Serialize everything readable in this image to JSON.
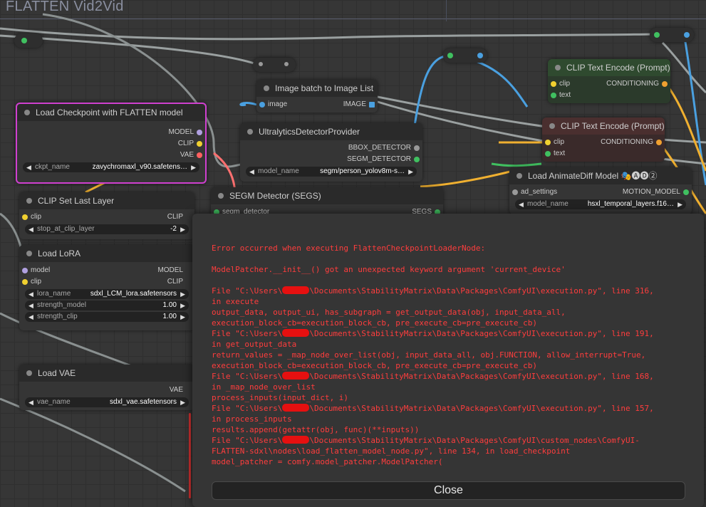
{
  "canvas": {
    "group_title": "FLATTEN Vid2Vid"
  },
  "nodes": {
    "load_checkpoint": {
      "title": "Load Checkpoint with FLATTEN model",
      "outputs": [
        "MODEL",
        "CLIP",
        "VAE"
      ],
      "widget_name": "ckpt_name",
      "widget_value": "zavychromaxl_v90.safetens…"
    },
    "clip_set_last_layer": {
      "title": "CLIP Set Last Layer",
      "input": "clip",
      "output": "CLIP",
      "widget_name": "stop_at_clip_layer",
      "widget_value": "-2"
    },
    "load_lora": {
      "title": "Load LoRA",
      "inputs": [
        "model",
        "clip"
      ],
      "outputs": [
        "MODEL",
        "CLIP"
      ],
      "widgets": [
        {
          "name": "lora_name",
          "value": "sdxl_LCM_lora.safetensors"
        },
        {
          "name": "strength_model",
          "value": "1.00"
        },
        {
          "name": "strength_clip",
          "value": "1.00"
        }
      ]
    },
    "load_vae": {
      "title": "Load VAE",
      "output": "VAE",
      "widget_name": "vae_name",
      "widget_value": "sdxl_vae.safetensors"
    },
    "image_batch": {
      "title": "Image batch to Image List",
      "input": "image",
      "output": "IMAGE"
    },
    "ultralytics": {
      "title": "UltralyticsDetectorProvider",
      "outputs": [
        "BBOX_DETECTOR",
        "SEGM_DETECTOR"
      ],
      "widget_name": "model_name",
      "widget_value": "segm/person_yolov8m-s…"
    },
    "segm_detector": {
      "title": "SEGM Detector (SEGS)",
      "input": "segm_detector",
      "output": "SEGS"
    },
    "clip_encode_pos": {
      "title": "CLIP Text Encode (Prompt)",
      "inputs": [
        "clip",
        "text"
      ],
      "output": "CONDITIONING"
    },
    "clip_encode_neg": {
      "title": "CLIP Text Encode (Prompt)",
      "inputs": [
        "clip",
        "text"
      ],
      "output": "CONDITIONING"
    },
    "animatediff": {
      "title": "Load AnimateDiff Model 🎭🅐🅓②",
      "input": "ad_settings",
      "output": "MOTION_MODEL",
      "widget_name": "model_name",
      "widget_value": "hsxl_temporal_layers.f16…"
    }
  },
  "error_dialog": {
    "lines": [
      "Error occurred when executing FlattenCheckpointLoaderNode:",
      "",
      "ModelPatcher.__init__() got an unexpected keyword argument 'current_device'",
      "",
      "File \"C:\\Users\\",
      "\\Documents\\StabilityMatrix\\Data\\Packages\\ComfyUI\\execution.py\", line 316,",
      "in execute",
      "output_data, output_ui, has_subgraph = get_output_data(obj, input_data_all,",
      "execution_block_cb=execution_block_cb, pre_execute_cb=pre_execute_cb)",
      "\\Documents\\StabilityMatrix\\Data\\Packages\\ComfyUI\\execution.py\", line 191,",
      "in get_output_data",
      "return_values = _map_node_over_list(obj, input_data_all, obj.FUNCTION, allow_interrupt=True,",
      "execution_block_cb=execution_block_cb, pre_execute_cb=pre_execute_cb)",
      "\\Documents\\StabilityMatrix\\Data\\Packages\\ComfyUI\\execution.py\", line 168,",
      "in _map_node_over_list",
      "process_inputs(input_dict, i)",
      "\\Documents\\StabilityMatrix\\Data\\Packages\\ComfyUI\\execution.py\", line 157,",
      "in process_inputs",
      "results.append(getattr(obj, func)(**inputs))",
      "\\Documents\\StabilityMatrix\\Data\\Packages\\ComfyUI\\custom_nodes\\ComfyUI-",
      "FLATTEN-sdxl\\nodes\\load_flatten_model_node.py\", line 134, in load_checkpoint",
      "model_patcher = comfy.model_patcher.ModelPatcher("
    ],
    "close_label": "Close"
  }
}
